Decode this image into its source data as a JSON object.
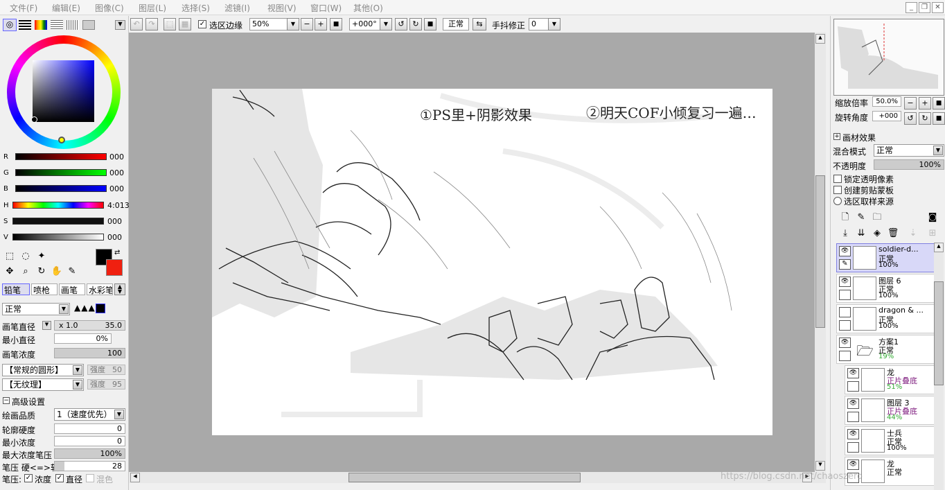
{
  "menu": [
    "文件(F)",
    "编辑(E)",
    "图像(C)",
    "图层(L)",
    "选择(S)",
    "滤镜(I)",
    "视图(V)",
    "窗口(W)",
    "其他(O)"
  ],
  "toolbar": {
    "select_edge": "选区边缘",
    "zoom": "50%",
    "rotate": "+000°",
    "blend": "正常",
    "stabilizer_label": "手抖修正",
    "stabilizer": "0"
  },
  "color": {
    "r": "000",
    "g": "000",
    "b": "000",
    "h": "4:013",
    "s": "000",
    "v": "000",
    "labels": [
      "R",
      "G",
      "B",
      "H",
      "S",
      "V"
    ]
  },
  "brush_tabs": [
    "铅笔",
    "喷枪",
    "画笔",
    "水彩笔"
  ],
  "brush": {
    "mode": "正常",
    "size_label": "画笔直径",
    "size_mult": "x 1.0",
    "size": "35.0",
    "min_size_label": "最小直径",
    "min_size": "0%",
    "density_label": "画笔浓度",
    "density": "100",
    "shape": "【常规的圆形】",
    "shape_strength_label": "强度",
    "shape_strength": "50",
    "texture": "【无纹理】",
    "texture_strength_label": "强度",
    "texture_strength": "95"
  },
  "advanced": {
    "title": "高级设置",
    "quality_label": "绘画品质",
    "quality": "1（速度优先）",
    "hardness_label": "轮廓硬度",
    "hardness": "0",
    "min_density_label": "最小浓度",
    "min_density": "0",
    "max_pressure_label": "最大浓度笔压",
    "max_pressure": "100%",
    "pressure_label": "笔压 硬<=>软",
    "pressure": "28",
    "pressure_opts_label": "笔压:",
    "opt_density": "浓度",
    "opt_size": "直径",
    "opt_blend": "混色"
  },
  "canvas_text": {
    "note1": "①PS里+阴影效果",
    "note2": "②明天COF小倾复习一遍…"
  },
  "navigator": {
    "zoom_label": "缩放倍率",
    "zoom": "50.0%",
    "rotate_label": "旋转角度",
    "rotate": "+000"
  },
  "layer_props": {
    "effect": "画材效果",
    "blend_label": "混合模式",
    "blend": "正常",
    "opacity_label": "不透明度",
    "opacity": "100%",
    "lock_alpha": "锁定透明像素",
    "clip": "创建剪贴蒙板",
    "sample": "选区取样来源"
  },
  "layers": [
    {
      "name": "soldier-d...",
      "mode": "正常",
      "opacity": "100%"
    },
    {
      "name": "图层 6",
      "mode": "正常",
      "opacity": "100%"
    },
    {
      "name": "dragon & ...",
      "mode": "正常",
      "opacity": "100%"
    },
    {
      "name": "方案1",
      "mode": "正常",
      "opacity": "19%"
    },
    {
      "name": "龙",
      "mode": "正片叠底",
      "opacity": "51%"
    },
    {
      "name": "图层 3",
      "mode": "正片叠底",
      "opacity": "44%"
    },
    {
      "name": "士兵",
      "mode": "正常",
      "opacity": "100%"
    },
    {
      "name": "龙",
      "mode": "正常",
      "opacity": ""
    }
  ],
  "watermark": "https://blog.csdn.net/chaoszero"
}
